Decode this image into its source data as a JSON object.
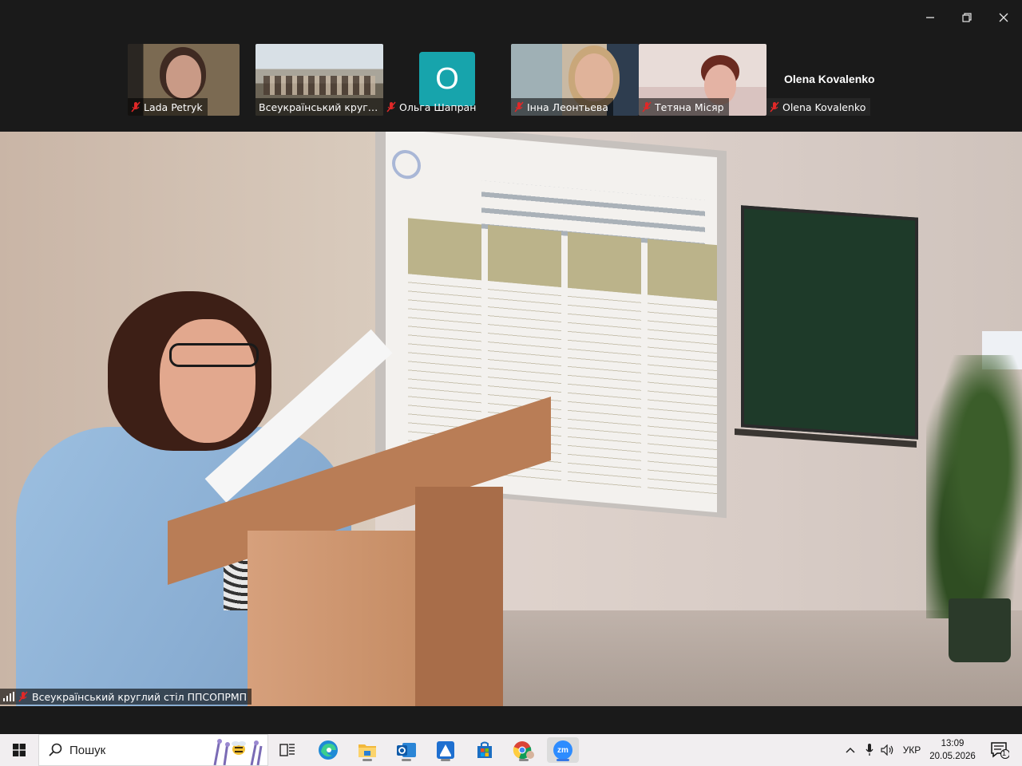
{
  "window": {
    "minimize_label": "Minimize",
    "restore_label": "Restore",
    "close_label": "Close"
  },
  "participants": [
    {
      "name": "Lada Petryk",
      "muted": true
    },
    {
      "name": "Всеукраїнський круглий ...",
      "muted": false
    },
    {
      "name": "Ольга Шапран",
      "muted": true,
      "avatar_letter": "O",
      "avatar_color": "#17a4ac"
    },
    {
      "name": "Інна Леонтьева",
      "muted": true
    },
    {
      "name": "Тетяна Місяр",
      "muted": true
    },
    {
      "name": "Olena Kovalenko",
      "muted": true,
      "display_name": "Olena Kovalenko"
    }
  ],
  "main_video": {
    "label": "Всеукраїнський круглий стіл ППСОПРМП"
  },
  "taskbar": {
    "search_placeholder": "Пошук",
    "apps": [
      {
        "name": "task-view-icon"
      },
      {
        "name": "edge-icon"
      },
      {
        "name": "file-explorer-icon"
      },
      {
        "name": "outlook-icon"
      },
      {
        "name": "app-icon"
      },
      {
        "name": "microsoft-store-icon"
      },
      {
        "name": "chrome-icon"
      },
      {
        "name": "zoom-icon",
        "label": "zm"
      }
    ],
    "language": "УКР",
    "time": "13:09",
    "date": "20.05.2026",
    "notification_count": "1"
  },
  "colors": {
    "window_bg": "#1a1a1a",
    "taskbar_bg": "#f1eef0",
    "mic_off": "#e02828",
    "zoom_blue": "#2d8cff"
  }
}
